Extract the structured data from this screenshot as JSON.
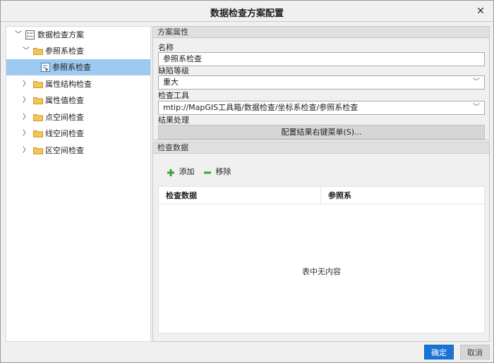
{
  "window": {
    "title": "数据检查方案配置",
    "close_glyph": "✕"
  },
  "tree": {
    "root": "数据检查方案",
    "group_ref": "参照系检查",
    "leaf_ref": "参照系检查",
    "items": [
      "属性结构检查",
      "属性值检查",
      "点空间检查",
      "线空间检查",
      "区空间检查"
    ],
    "chevron_open": "﹀",
    "chevron_closed": "〉"
  },
  "plan": {
    "header": "方案属性",
    "name_label": "名称",
    "name_value": "参照系检查",
    "level_label": "缺陷等级",
    "level_value": "重大",
    "tool_label": "检查工具",
    "tool_value": "mtip://MapGIS工具箱/数据检查/坐标系检查/参照系检查",
    "result_label": "结果处理",
    "result_button": "配置结果右键菜单(S)..."
  },
  "checkdata": {
    "header": "检查数据",
    "add_label": "添加",
    "remove_label": "移除",
    "columns": [
      "检查数据",
      "参照系"
    ],
    "empty_text": "表中无内容"
  },
  "footer": {
    "ok": "确定",
    "cancel": "取消"
  },
  "colors": {
    "accent": "#1a73d6",
    "selection": "#9ec9f0",
    "add": "#3aa23a",
    "folder": "#f2c45a"
  }
}
